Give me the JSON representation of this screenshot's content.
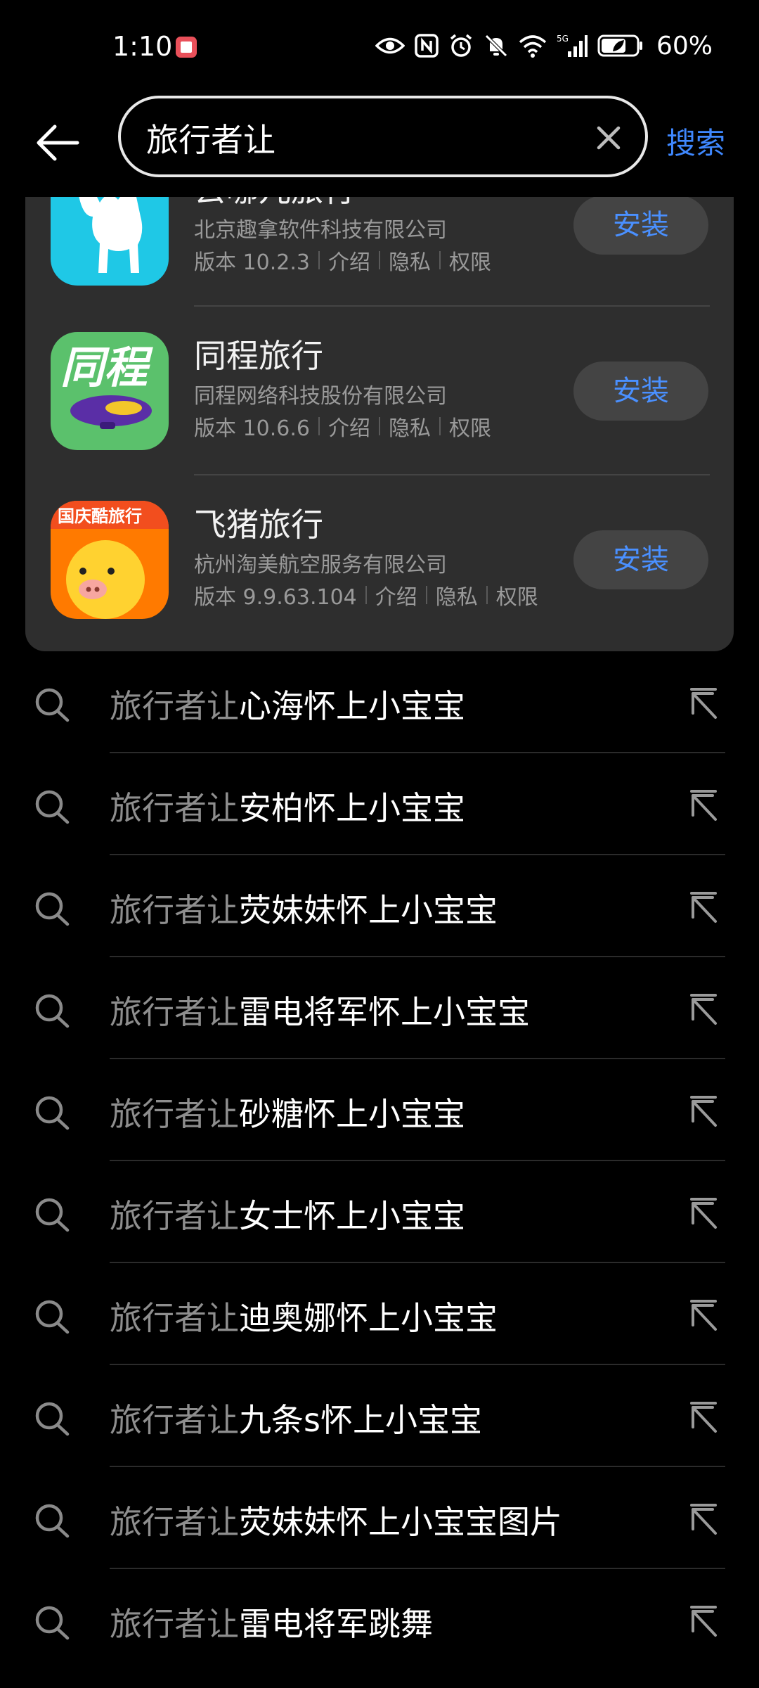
{
  "status_bar": {
    "time": "1:10",
    "network": "5G",
    "battery": "60%"
  },
  "header": {
    "query": "旅行者让",
    "search_label": "搜索"
  },
  "apps": [
    {
      "name": "去哪儿旅行",
      "developer": "北京趣拿软件科技有限公司",
      "version": "版本 10.2.3",
      "intro": "介绍",
      "privacy": "隐私",
      "permissions": "权限",
      "install": "安装",
      "icon": "camel-icon"
    },
    {
      "name": "同程旅行",
      "developer": "同程网络科技股份有限公司",
      "version": "版本 10.6.6",
      "intro": "介绍",
      "privacy": "隐私",
      "permissions": "权限",
      "install": "安装",
      "icon_text": "同程"
    },
    {
      "name": "飞猪旅行",
      "developer": "杭州淘美航空服务有限公司",
      "version": "版本 9.9.63.104",
      "intro": "介绍",
      "privacy": "隐私",
      "permissions": "权限",
      "install": "安装",
      "icon_text": "国庆酷旅行"
    }
  ],
  "suggestions": [
    {
      "query": "旅行者让",
      "rest": "心海怀上小宝宝"
    },
    {
      "query": "旅行者让",
      "rest": "安柏怀上小宝宝"
    },
    {
      "query": "旅行者让",
      "rest": "荧妹妹怀上小宝宝"
    },
    {
      "query": "旅行者让",
      "rest": "雷电将军怀上小宝宝"
    },
    {
      "query": "旅行者让",
      "rest": "砂糖怀上小宝宝"
    },
    {
      "query": "旅行者让",
      "rest": "女士怀上小宝宝"
    },
    {
      "query": "旅行者让",
      "rest": "迪奥娜怀上小宝宝"
    },
    {
      "query": "旅行者让",
      "rest": "九条s怀上小宝宝"
    },
    {
      "query": "旅行者让",
      "rest": "荧妹妹怀上小宝宝图片"
    },
    {
      "query": "旅行者让",
      "rest": "雷电将军跳舞"
    }
  ]
}
